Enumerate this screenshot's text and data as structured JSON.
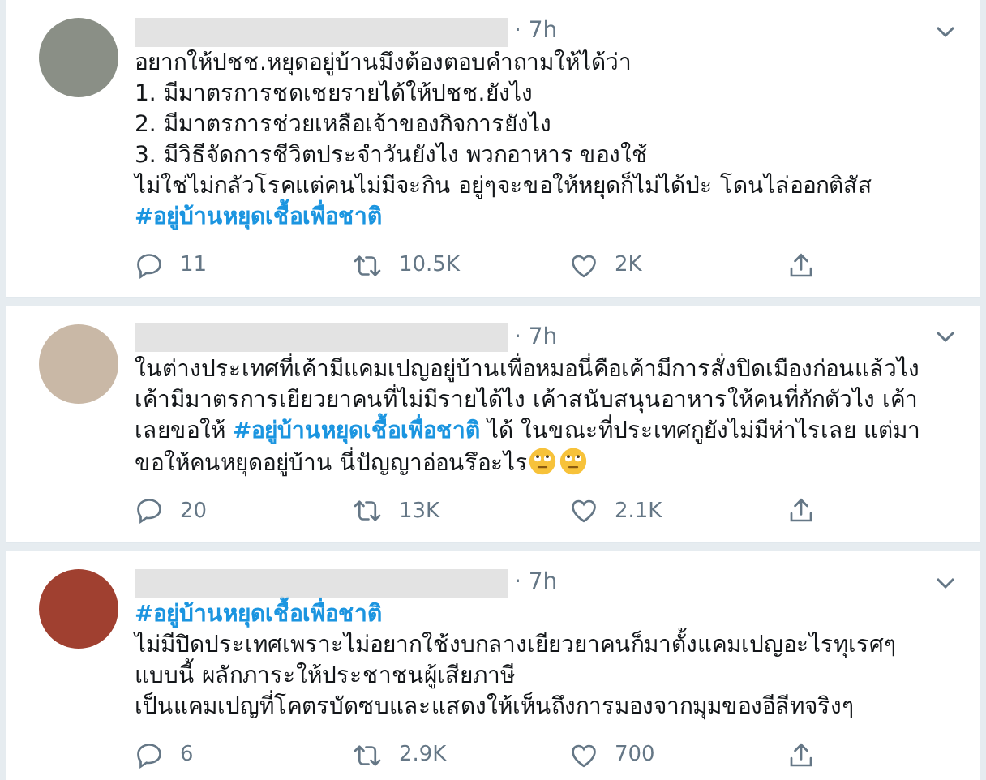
{
  "tweets": [
    {
      "time": "· 7h",
      "body": [
        {
          "kind": "text",
          "text": "อยากให้ปชช.หยุดอยู่บ้านมึงต้องตอบคำถามให้ได้ว่า\n1. มีมาตรการชดเชยรายได้ให้ปชช.ยังไง\n2. มีมาตรการช่วยเหลือเจ้าของกิจการยังไง\n3. มีวิธีจัดการชีวิตประจำวันยังไง พวกอาหาร ของใช้\nไม่ใช่ไม่กลัวโรคแต่คนไม่มีจะกิน อยู่ๆจะขอให้หยุดก็ไม่ได้ป่ะ โดนไล่ออกติสัส "
        },
        {
          "kind": "hashtag",
          "text": "#อยู่บ้านหยุดเชื้อเพื่อชาติ"
        }
      ],
      "replies": "11",
      "retweets": "10.5K",
      "likes": "2K"
    },
    {
      "time": "· 7h",
      "body": [
        {
          "kind": "text",
          "text": "ในต่างประเทศที่เค้ามีแคมเปญอยู่บ้านเพื่อหมอนี่คือเค้ามีการสั่งปิดเมืองก่อนแล้วไง เค้ามีมาตรการเยียวยาคนที่ไม่มีรายได้ไง เค้าสนับสนุนอาหารให้คนที่กักตัวไง เค้าเลยขอให้ "
        },
        {
          "kind": "hashtag",
          "text": "#อยู่บ้านหยุดเชื้อเพื่อชาติ"
        },
        {
          "kind": "text",
          "text": " ได้ ในขณะที่ประเทศกูยังไม่มีห่าไรเลย แต่มาขอให้คนหยุดอยู่บ้าน นี่ปัญญาอ่อนรึอะไร"
        },
        {
          "kind": "emoji"
        },
        {
          "kind": "emoji"
        }
      ],
      "replies": "20",
      "retweets": "13K",
      "likes": "2.1K"
    },
    {
      "time": "· 7h",
      "body": [
        {
          "kind": "hashtag",
          "text": "#อยู่บ้านหยุดเชื้อเพื่อชาติ"
        },
        {
          "kind": "text",
          "text": "\nไม่มีปิดประเทศเพราะไม่อยากใช้งบกลางเยียวยาคนก็มาตั้งแคมเปญอะไรทุเรศๆแบบนี้ ผลักภาระให้ประชาชนผู้เสียภาษี\nเป็นแคมเปญที่โคตรบัดซบและแสดงให้เห็นถึงการมองจากมุมของอีลีทจริงๆ"
        }
      ],
      "replies": "6",
      "retweets": "2.9K",
      "likes": "700"
    }
  ]
}
